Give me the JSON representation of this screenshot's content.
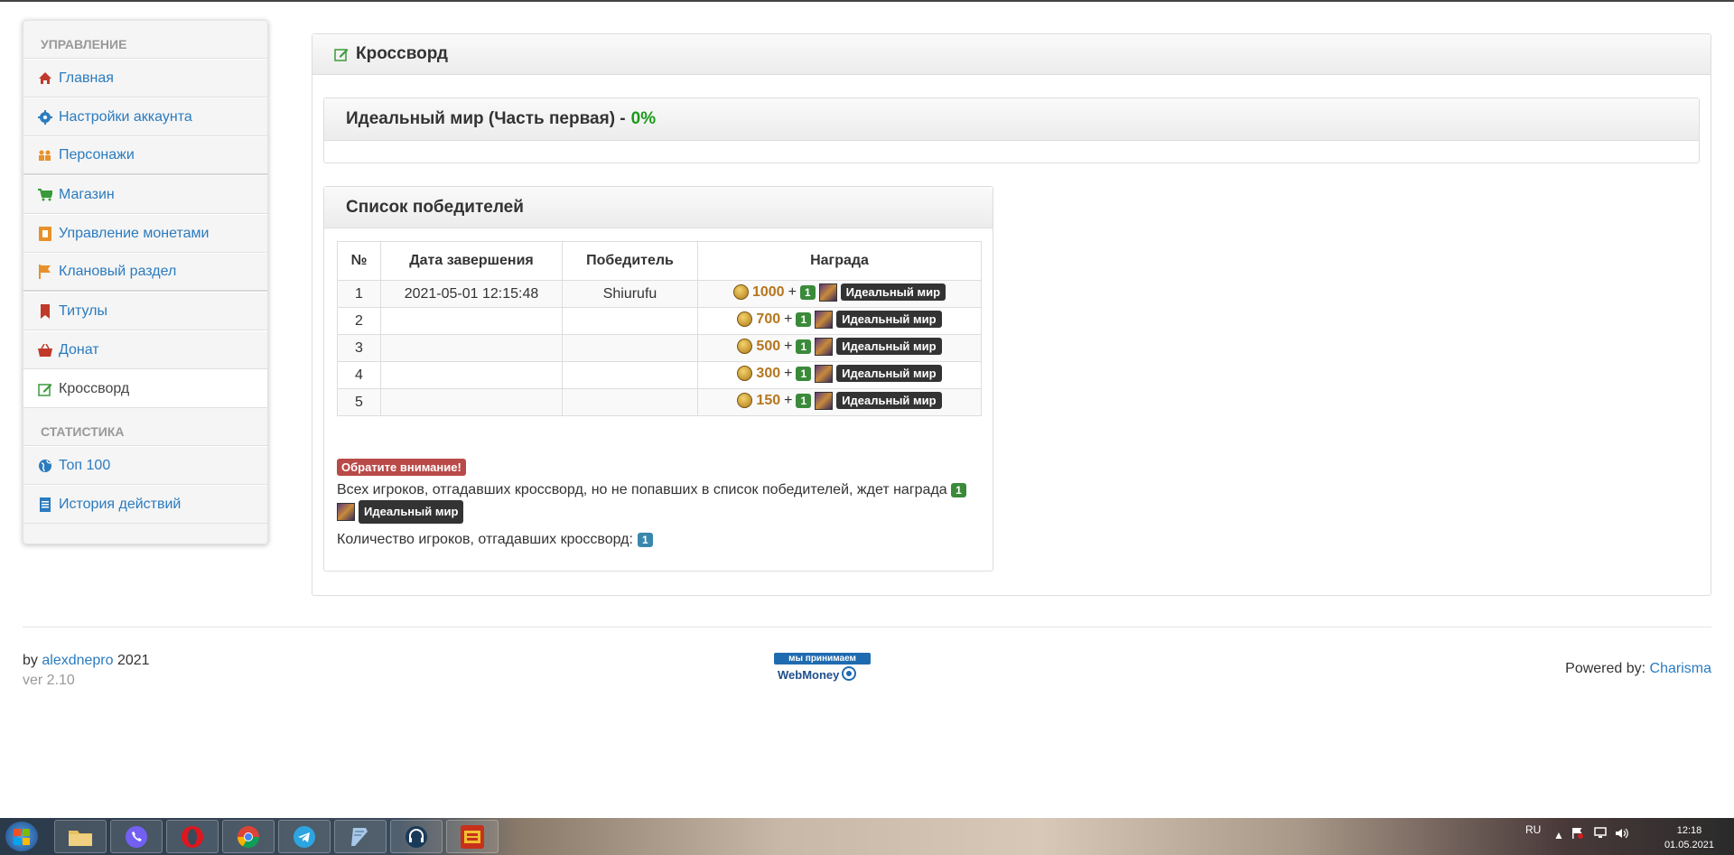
{
  "sidebar": {
    "section_manage": "Управление",
    "items_manage": [
      {
        "label": "Главная",
        "icon": "home-icon"
      },
      {
        "label": "Настройки аккаунта",
        "icon": "gear-icon"
      },
      {
        "label": "Персонажи",
        "icon": "users-icon"
      },
      {
        "label": "Магазин",
        "icon": "cart-icon"
      },
      {
        "label": "Управление монетами",
        "icon": "coins-icon"
      },
      {
        "label": "Клановый раздел",
        "icon": "flag-icon"
      },
      {
        "label": "Титулы",
        "icon": "bookmark-icon"
      },
      {
        "label": "Донат",
        "icon": "basket-icon"
      },
      {
        "label": "Кроссворд",
        "icon": "edit-icon"
      }
    ],
    "section_stats": "Статистика",
    "items_stats": [
      {
        "label": "Топ 100",
        "icon": "globe-icon"
      },
      {
        "label": "История действий",
        "icon": "document-icon"
      }
    ]
  },
  "main": {
    "title": "Кроссворд",
    "crossword": {
      "name": "Идеальный мир (Часть первая) -",
      "progress": "0%"
    },
    "winners": {
      "title": "Список победителей",
      "columns": [
        "№",
        "Дата завершения",
        "Победитель",
        "Награда"
      ],
      "rows": [
        {
          "num": "1",
          "date": "2021-05-01 12:15:48",
          "winner": "Shiurufu",
          "coins": "1000"
        },
        {
          "num": "2",
          "date": "",
          "winner": "",
          "coins": "700"
        },
        {
          "num": "3",
          "date": "",
          "winner": "",
          "coins": "500"
        },
        {
          "num": "4",
          "date": "",
          "winner": "",
          "coins": "300"
        },
        {
          "num": "5",
          "date": "",
          "winner": "",
          "coins": "150"
        }
      ],
      "plus": "+",
      "item_count": "1",
      "item_name": "Идеальный мир"
    },
    "notice": {
      "label": "Обратите внимание!",
      "text": "Всех игроков, отгадавших кроссворд, но не попавших в список победителей, ждет награда",
      "item_count": "1",
      "item_name": "Идеальный мир"
    },
    "solved": {
      "label": "Количество игроков, отгадавших кроссворд:",
      "count": "1"
    }
  },
  "footer": {
    "by": "by",
    "author": "alexdnepro",
    "year": "2021",
    "version": "ver 2.10",
    "webmoney_top": "мы принимаем",
    "webmoney_brand": "WebMoney",
    "powered_label": "Powered by:",
    "powered_link": "Charisma"
  },
  "taskbar": {
    "apps": [
      "explorer-icon",
      "viber-icon",
      "opera-icon",
      "chrome-icon",
      "telegram-icon",
      "notepad-icon",
      "headset-icon",
      "game-icon"
    ],
    "lang": "RU",
    "time": "12:18",
    "date": "01.05.2021"
  },
  "colors": {
    "link": "#2a7bbf",
    "progress": "#1a9a1a",
    "coin_amount": "#b5761e",
    "badge_green": "#3a8a3a",
    "badge_blue": "#3a87ad",
    "badge_red": "#b94a48"
  }
}
